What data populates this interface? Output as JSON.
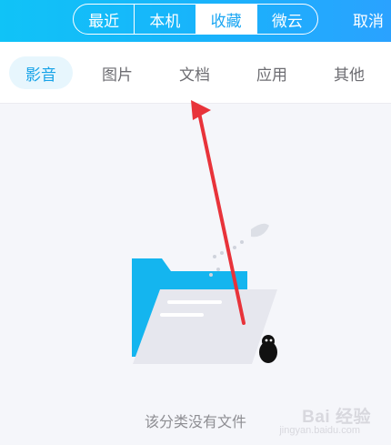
{
  "header": {
    "segments": [
      {
        "label": "最近"
      },
      {
        "label": "本机"
      },
      {
        "label": "收藏"
      },
      {
        "label": "微云"
      }
    ],
    "active_segment": "收藏",
    "cancel_label": "取消"
  },
  "category_tabs": [
    {
      "label": "影音"
    },
    {
      "label": "图片"
    },
    {
      "label": "文档"
    },
    {
      "label": "应用"
    },
    {
      "label": "其他"
    }
  ],
  "active_tab": "影音",
  "empty_state": {
    "message": "该分类没有文件"
  },
  "watermark": {
    "brand": "Bai 经验",
    "sub": "jingyan.baidu.com"
  },
  "colors": {
    "header_start": "#10c3f7",
    "header_end": "#2aa2ff",
    "active_tab_bg": "#e7f6fd",
    "active_tab_text": "#16a3e8",
    "arrow": "#e8333a",
    "folder_blue": "#14b5ef"
  }
}
